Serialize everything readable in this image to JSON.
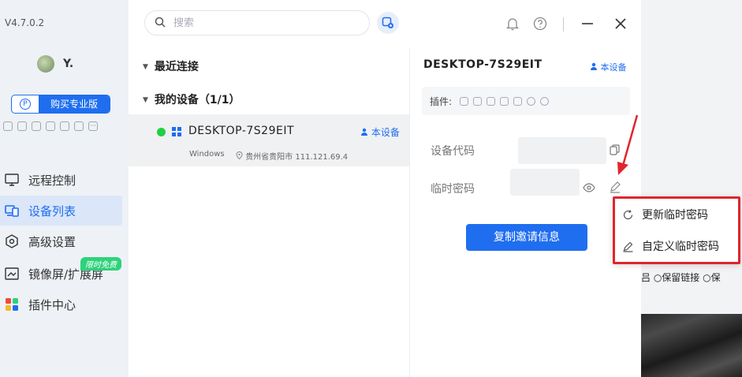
{
  "app": {
    "version": "V4.7.0.2",
    "username": "Y."
  },
  "sidebar": {
    "buy_label": "购买专业版",
    "pro_badge": "P",
    "more_plugins": "···",
    "free_badge": "限时免费",
    "items": [
      {
        "label": "远程控制",
        "icon": "monitor-icon"
      },
      {
        "label": "设备列表",
        "icon": "devices-icon"
      },
      {
        "label": "高级设置",
        "icon": "settings-icon"
      },
      {
        "label": "镜像屏/扩展屏",
        "icon": "mirror-screen-icon"
      },
      {
        "label": "插件中心",
        "icon": "plugin-center-icon"
      }
    ]
  },
  "search": {
    "placeholder": "搜索"
  },
  "groups": {
    "recent": "最近连接",
    "mine": "我的设备（1/1）"
  },
  "device": {
    "name": "DESKTOP-7S29EIT",
    "tag": "本设备",
    "os": "Windows",
    "location": "贵州省贵阳市 111.121.69.4",
    "status_color": "#1fd043"
  },
  "detail": {
    "title": "DESKTOP-7S29EIT",
    "tag": "本设备",
    "plugins_label": "插件:",
    "code_label": "设备代码",
    "pwd_label": "临时密码",
    "copy_label": "复制邀请信息"
  },
  "menu": {
    "refresh": "更新临时密码",
    "custom": "自定义临时密码"
  },
  "background_window": {
    "options": "吕 ○保留链接 ○保"
  },
  "colors": {
    "accent": "#1f6ef0",
    "highlight": "#e0252d",
    "online": "#1fd043"
  }
}
